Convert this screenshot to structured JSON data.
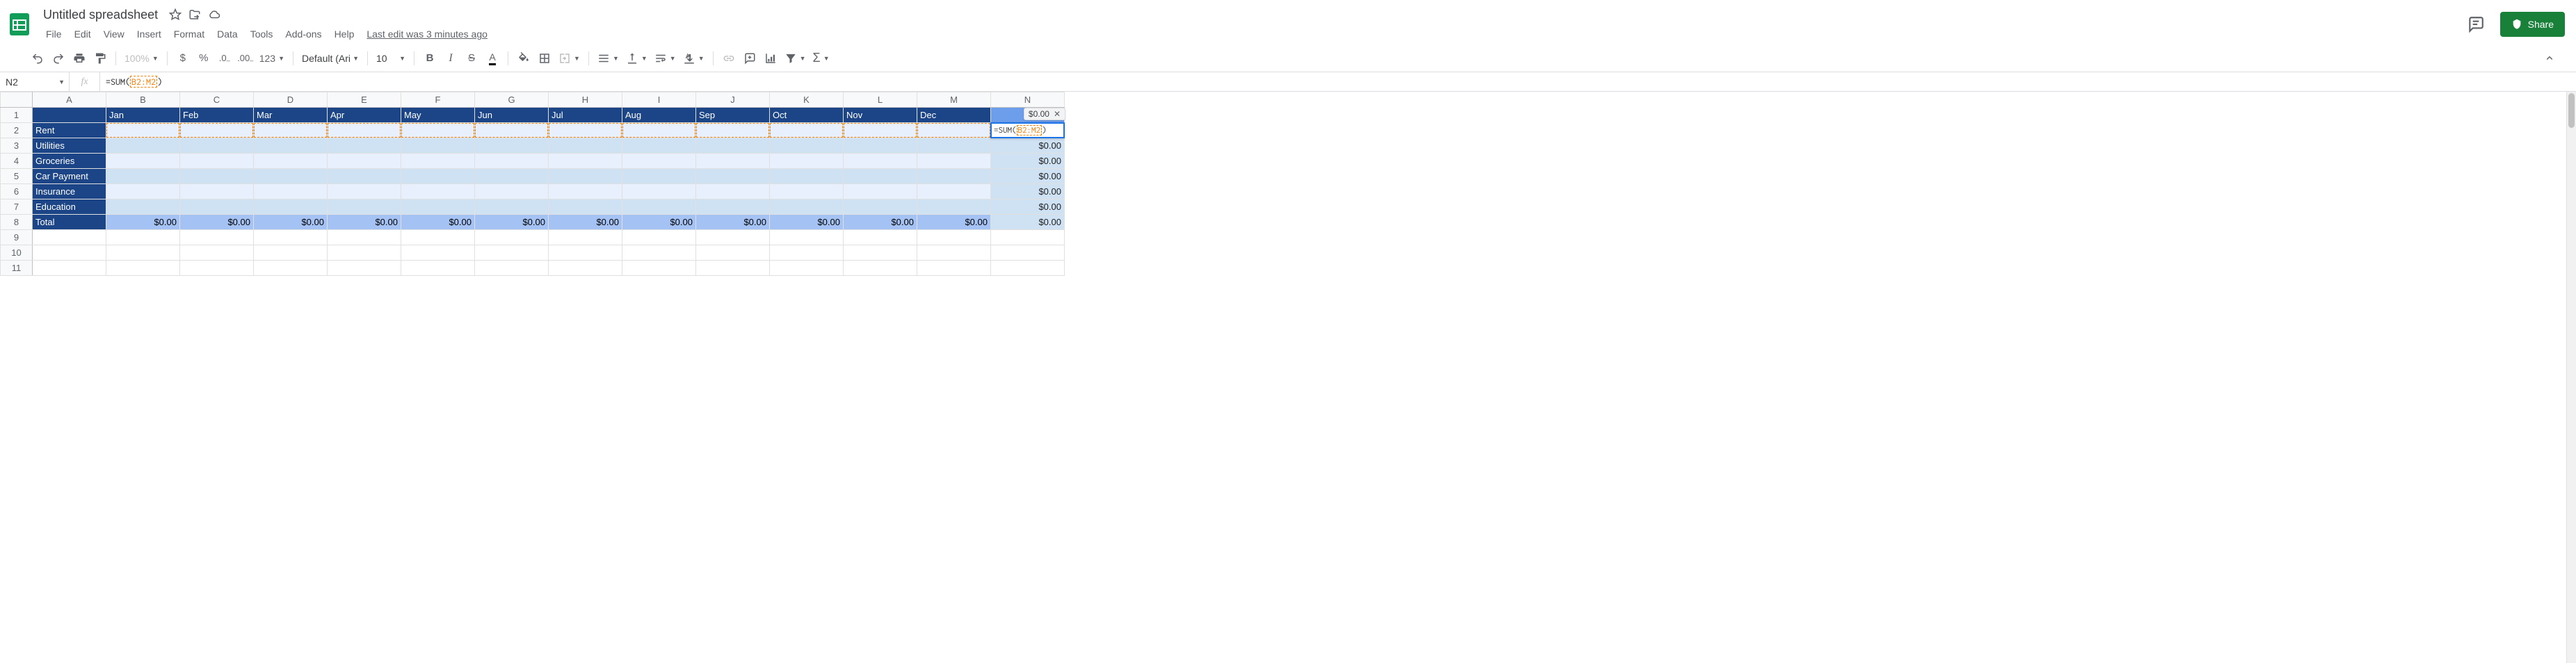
{
  "header": {
    "title": "Untitled spreadsheet",
    "last_edit": "Last edit was 3 minutes ago",
    "share_label": "Share",
    "menus": [
      "File",
      "Edit",
      "View",
      "Insert",
      "Format",
      "Data",
      "Tools",
      "Add-ons",
      "Help"
    ]
  },
  "toolbar": {
    "zoom": "100%",
    "font_name": "Default (Ari…",
    "font_size": "10",
    "number_fmt": "123"
  },
  "formula_bar": {
    "cell_ref": "N2",
    "fx_label": "fx",
    "formula_prefix": "=SUM(",
    "formula_range": "B2:M2",
    "formula_suffix": ")"
  },
  "preview": {
    "value": "$0.00"
  },
  "chart_data": {
    "type": "table",
    "columns": [
      "",
      "A",
      "B",
      "C",
      "D",
      "E",
      "F",
      "G",
      "H",
      "I",
      "J",
      "K",
      "L",
      "M",
      "N"
    ],
    "month_headers": [
      "Jan",
      "Feb",
      "Mar",
      "Apr",
      "May",
      "Jun",
      "Jul",
      "Aug",
      "Sep",
      "Oct",
      "Nov",
      "Dec"
    ],
    "row_categories": [
      "Rent",
      "Utilities",
      "Groceries",
      "Car Payment",
      "Insurance",
      "Education",
      "Total"
    ],
    "n_column_values": [
      "",
      "$0.00",
      "$0.00",
      "$0.00",
      "$0.00",
      "$0.00",
      "$0.00"
    ],
    "total_row_values": [
      "$0.00",
      "$0.00",
      "$0.00",
      "$0.00",
      "$0.00",
      "$0.00",
      "$0.00",
      "$0.00",
      "$0.00",
      "$0.00",
      "$0.00",
      "$0.00",
      "$0.00"
    ],
    "empty_rows": [
      "9",
      "10",
      "11"
    ]
  }
}
